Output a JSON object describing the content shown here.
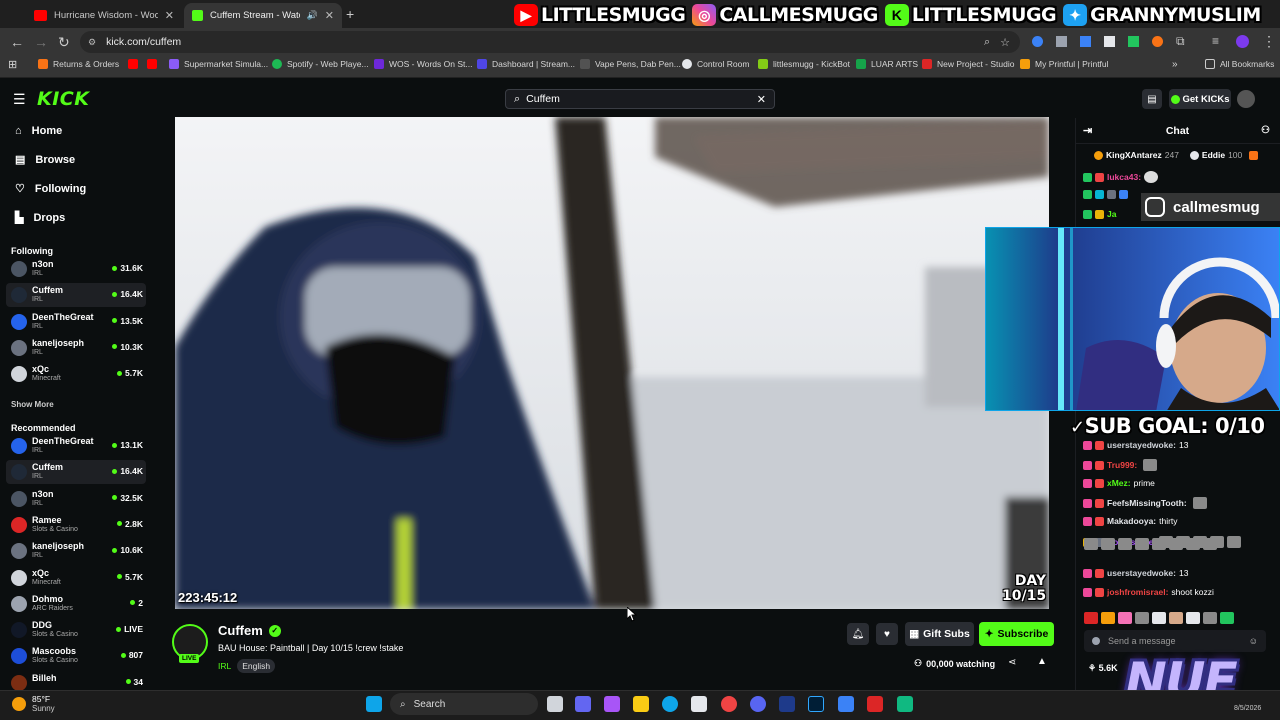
{
  "browser": {
    "tabs": [
      {
        "title": "Hurricane Wisdom - Woosah (C",
        "close": "✕"
      },
      {
        "title": "Cuffem Stream - Watch Live",
        "close": "✕"
      }
    ],
    "new_tab": "+",
    "url": "kick.com/cuffem",
    "bookmarks": [
      "Returns & Orders",
      "Supermarket Simula...",
      "Spotify - Web Playe...",
      "WOS - Words On St...",
      "Dashboard | Stream...",
      "Vape Pens, Dab Pen...",
      "Control Room",
      "littlesmugg - KickBot",
      "LUAR ARTS",
      "New Project - Studio",
      "My Printful | Printful",
      "All Bookmarks"
    ]
  },
  "overlay": {
    "banner": [
      "LITTLESMUGG",
      "CALLMESMUGG",
      "LITTLESMUGG",
      "GRANNYMUSLIM"
    ],
    "instagram": "callmesmug",
    "sub_goal": "SUB GOAL: 0/10",
    "logo": "NUE"
  },
  "kick": {
    "logo": "KICK",
    "search_value": "Cuffem",
    "get_kicks": "Get KICKs",
    "nav": [
      "Home",
      "Browse",
      "Following",
      "Drops"
    ],
    "following_header": "Following",
    "following": [
      {
        "name": "n3on",
        "cat": "IRL",
        "viewers": "31.6K",
        "color": "#4b5563"
      },
      {
        "name": "Cuffem",
        "cat": "IRL",
        "viewers": "16.4K",
        "color": "#1f2937",
        "selected": true
      },
      {
        "name": "DeenTheGreat",
        "cat": "IRL",
        "viewers": "13.5K",
        "color": "#2563eb"
      },
      {
        "name": "kaneljoseph",
        "cat": "IRL",
        "viewers": "10.3K",
        "color": "#6b7280"
      },
      {
        "name": "xQc",
        "cat": "Minecraft",
        "viewers": "5.7K",
        "color": "#d1d5db"
      }
    ],
    "show_more": "Show More",
    "recommended_header": "Recommended",
    "recommended": [
      {
        "name": "DeenTheGreat",
        "cat": "IRL",
        "viewers": "13.1K",
        "color": "#2563eb"
      },
      {
        "name": "Cuffem",
        "cat": "IRL",
        "viewers": "16.4K",
        "color": "#1f2937",
        "selected": true
      },
      {
        "name": "n3on",
        "cat": "IRL",
        "viewers": "32.5K",
        "color": "#4b5563"
      },
      {
        "name": "Ramee",
        "cat": "Slots & Casino",
        "viewers": "2.8K",
        "color": "#dc2626"
      },
      {
        "name": "kaneljoseph",
        "cat": "IRL",
        "viewers": "10.6K",
        "color": "#6b7280"
      },
      {
        "name": "xQc",
        "cat": "Minecraft",
        "viewers": "5.7K",
        "color": "#d1d5db"
      },
      {
        "name": "Dohmo",
        "cat": "ARC Raiders",
        "viewers": "2",
        "color": "#9ca3af"
      },
      {
        "name": "DDG",
        "cat": "Slots & Casino",
        "viewers": "LIVE",
        "color": "#111827"
      },
      {
        "name": "Mascoobs",
        "cat": "Slots & Casino",
        "viewers": "807",
        "color": "#1d4ed8"
      },
      {
        "name": "Billeh",
        "cat": "",
        "viewers": "34",
        "color": "#7c2d12"
      }
    ]
  },
  "stream": {
    "timecode": "223:45:12",
    "day_line1": "DAY",
    "day_line2": "10/15",
    "streamer": "Cuffem",
    "live": "LIVE",
    "title": "BAU House: Paintball | Day 10/15  !crew !stake",
    "category": "IRL",
    "language": "English",
    "gift_subs": "Gift Subs",
    "subscribe": "Subscribe",
    "watching": "00,000 watching"
  },
  "chat": {
    "title": "Chat",
    "top_gifters": [
      {
        "name": "KingXAntarez",
        "count": "247"
      },
      {
        "name": "Eddie",
        "count": "100"
      }
    ],
    "messages_top": [
      {
        "user": "lukca43:",
        "text": "",
        "color": "#ec4899"
      },
      {
        "user": "Ja",
        "text": "",
        "color": "#53fc18"
      }
    ],
    "messages": [
      {
        "user": "userstayedwoke:",
        "text": "13",
        "color": "#d1d5db"
      },
      {
        "user": "Tru999:",
        "text": "",
        "color": "#ef4444"
      },
      {
        "user": "xMez:",
        "text": "prime",
        "color": "#53fc18"
      },
      {
        "user": "FeefsMissingTooth:",
        "text": "",
        "color": "#e5e7eb"
      },
      {
        "user": "Makadooya:",
        "text": "thirty",
        "color": "#e5e7eb"
      },
      {
        "user": "Hopeishere:",
        "text": "",
        "color": "#a855f7"
      },
      {
        "user": "userstayedwoke:",
        "text": "13",
        "color": "#d1d5db"
      },
      {
        "user": "joshfromisrael:",
        "text": "shoot kozzi",
        "color": "#ef4444"
      }
    ],
    "placeholder": "Send a message",
    "points": "5.6K"
  },
  "taskbar": {
    "temp": "85°F",
    "condition": "Sunny",
    "search": "Search",
    "date": "8/5/2026"
  }
}
